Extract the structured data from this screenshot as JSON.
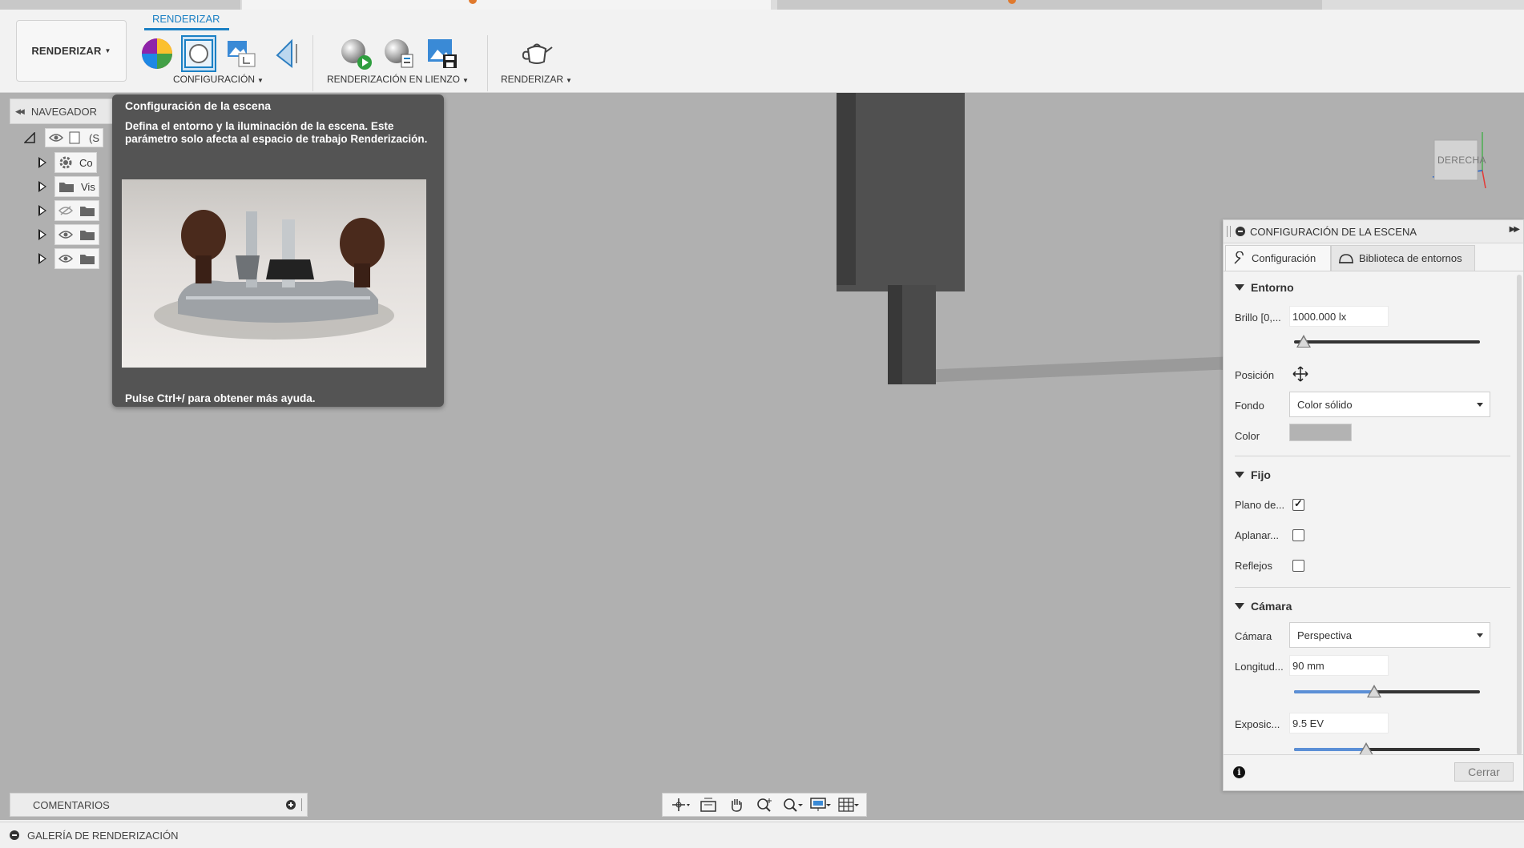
{
  "ribbon": {
    "workspace_button": "RENDERIZAR",
    "active_tab": "RENDERIZAR",
    "groups": {
      "configuracion": "CONFIGURACIÓN",
      "renderizacion_lienzo": "RENDERIZACIÓN EN LIENZO",
      "renderizar": "RENDERIZAR"
    }
  },
  "navigator": {
    "title": "NAVEGADOR",
    "root_label": "(S",
    "items": [
      {
        "label": "Co",
        "icon": "gear-icon"
      },
      {
        "label": "Vis",
        "icon": "folder-icon"
      },
      {
        "label": "",
        "icon": "folder-icon",
        "visibility": "hidden"
      },
      {
        "label": "",
        "icon": "folder-icon",
        "visibility": "visible"
      },
      {
        "label": "",
        "icon": "folder-icon",
        "visibility": "visible"
      }
    ]
  },
  "tooltip": {
    "title": "Configuración de la escena",
    "description": "Defina el entorno y la iluminación de la escena. Este parámetro solo afecta al espacio de trabajo Renderización.",
    "help": "Pulse Ctrl+/ para obtener más ayuda."
  },
  "viewcube": {
    "face": "DERECHA"
  },
  "scene_panel": {
    "title": "CONFIGURACIÓN DE LA ESCENA",
    "tabs": [
      "Configuración",
      "Biblioteca de entornos"
    ],
    "entorno": {
      "heading": "Entorno",
      "brillo_label": "Brillo [0,...",
      "brillo_value": "1000.000 lx",
      "brillo_slider_fraction": 0.05,
      "posicion_label": "Posición",
      "fondo_label": "Fondo",
      "fondo_value": "Color sólido",
      "color_label": "Color",
      "color_swatch": "#b3b3b3"
    },
    "fijo": {
      "heading": "Fijo",
      "plano_label": "Plano de...",
      "plano_checked": true,
      "aplanar_label": "Aplanar...",
      "aplanar_checked": false,
      "reflejos_label": "Reflejos",
      "reflejos_checked": false
    },
    "camara": {
      "heading": "Cámara",
      "camara_label": "Cámara",
      "camara_value": "Perspectiva",
      "longitud_label": "Longitud...",
      "longitud_value": "90 mm",
      "longitud_slider_fraction": 0.43,
      "exposicion_label": "Exposic...",
      "exposicion_value": "9.5 EV",
      "exposicion_slider_fraction": 0.39
    },
    "close_label": "Cerrar"
  },
  "bottom": {
    "comments": "COMENTARIOS",
    "gallery": "GALERÍA DE RENDERIZACIÓN"
  },
  "colors": {
    "accent": "#1b80c4",
    "viewport": "#b0b0b0",
    "tooltip_bg": "#545454",
    "slider_fill": "#5b8fd6"
  }
}
